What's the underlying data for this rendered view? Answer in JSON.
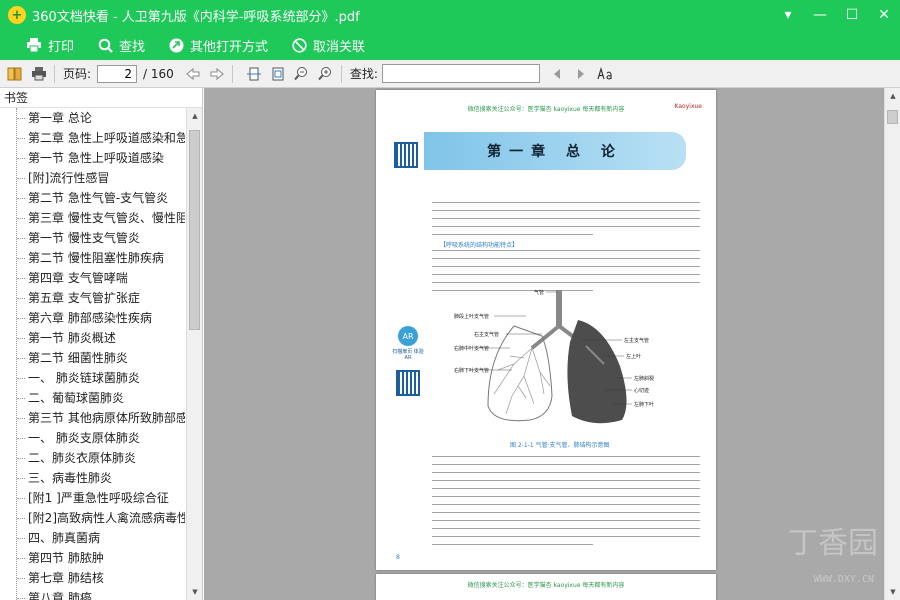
{
  "window": {
    "title": "360文档快看 - 人卫第九版《内科学-呼吸系统部分》.pdf",
    "controls": [
      "▾",
      "—",
      "☐",
      "✕"
    ]
  },
  "toolbar": {
    "print": "打印",
    "find": "查找",
    "open_with": "其他打开方式",
    "unlink": "取消关联"
  },
  "nav": {
    "page_label": "页码:",
    "page_value": "2",
    "page_total": "/ 160",
    "search_label": "查找:",
    "search_value": ""
  },
  "sidebar": {
    "title": "书签",
    "items": [
      "第一章 总论",
      "第二章 急性上呼吸道感染和急",
      "第一节 急性上呼吸道感染",
      "[附]流行性感冒",
      "第二节 急性气管-支气管炎",
      "第三章 慢性支气管炎、慢性阻",
      "第一节 慢性支气管炎",
      "第二节 慢性阻塞性肺疾病",
      "第四章 支气管哮喘",
      "第五章 支气管扩张症",
      "第六章 肺部感染性疾病",
      "第一节 肺炎概述",
      "第二节 细菌性肺炎",
      "一、 肺炎链球菌肺炎",
      "二、葡萄球菌肺炎",
      "第三节 其他病原体所致肺部感",
      "一、 肺炎支原体肺炎",
      "二、肺炎衣原体肺炎",
      "三、病毒性肺炎",
      "[附1 ]严重急性呼吸综合征",
      "[附2]高致病性人禽流感病毒性",
      "四、肺真菌病",
      "第四节 肺脓肿",
      "第七章 肺结核",
      "第八章 肺癌"
    ]
  },
  "document": {
    "header": "微信搜索关注公众号：医学猫杏 kaoyixue 每天都有新内容",
    "header_right": "Kaoyixue",
    "chapter_title": "第一章 总 论",
    "section_head": "【呼吸系统的结构功能特点】",
    "figure_caption": "图 2-1-1 气管·支气管、肺结构示意图",
    "page_number": "8",
    "footer": "微信搜索关注公众号：医学猫杏 kaoyixue 每天都有新内容",
    "qr_tag": "AR",
    "qr_tag_text": "扫描扉页 体验AR",
    "fig_labels": [
      "气管",
      "肺段上叶支气管",
      "右主支气管",
      "右肺中叶支气管",
      "右肺下叶支气管",
      "左主支气管",
      "左上叶",
      "左肺斜裂",
      "心切迹",
      "左肺下叶"
    ]
  },
  "watermark": {
    "brand": "丁香园",
    "url": "WWW.DXY.CN"
  },
  "colors": {
    "accent": "#1ec95a",
    "link": "#2d7fc7"
  }
}
